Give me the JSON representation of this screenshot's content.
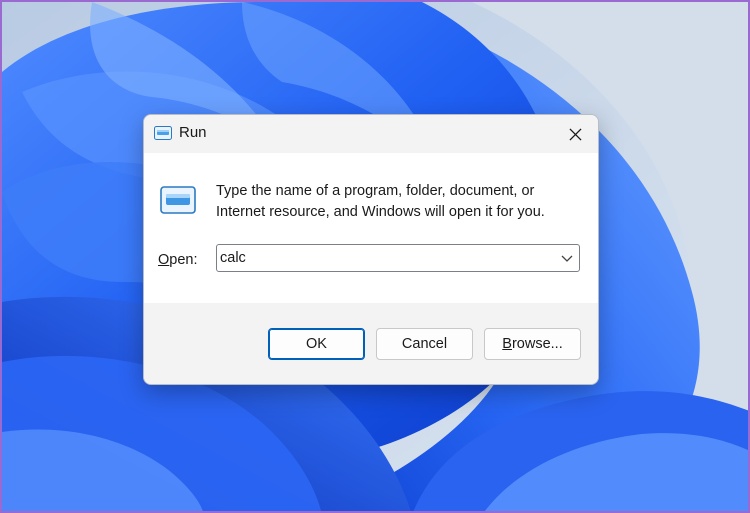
{
  "dialog": {
    "title": "Run",
    "description_line1": "Type the name of a program, folder, document, or",
    "description_line2": "Internet resource, and Windows will open it for you.",
    "open_label_mnemonic": "O",
    "open_label_rest": "pen:",
    "open_value": "calc",
    "buttons": {
      "ok": "OK",
      "cancel": "Cancel",
      "browse_mnemonic": "B",
      "browse_rest": "rowse..."
    }
  },
  "icons": {
    "title": "run-icon",
    "close": "close-icon",
    "dropdown": "chevron-down-icon"
  },
  "colors": {
    "accent": "#005fb8",
    "wallpaper_blue": "#1f5ff2",
    "dialog_bg": "#f3f3f3",
    "content_bg": "#ffffff"
  }
}
